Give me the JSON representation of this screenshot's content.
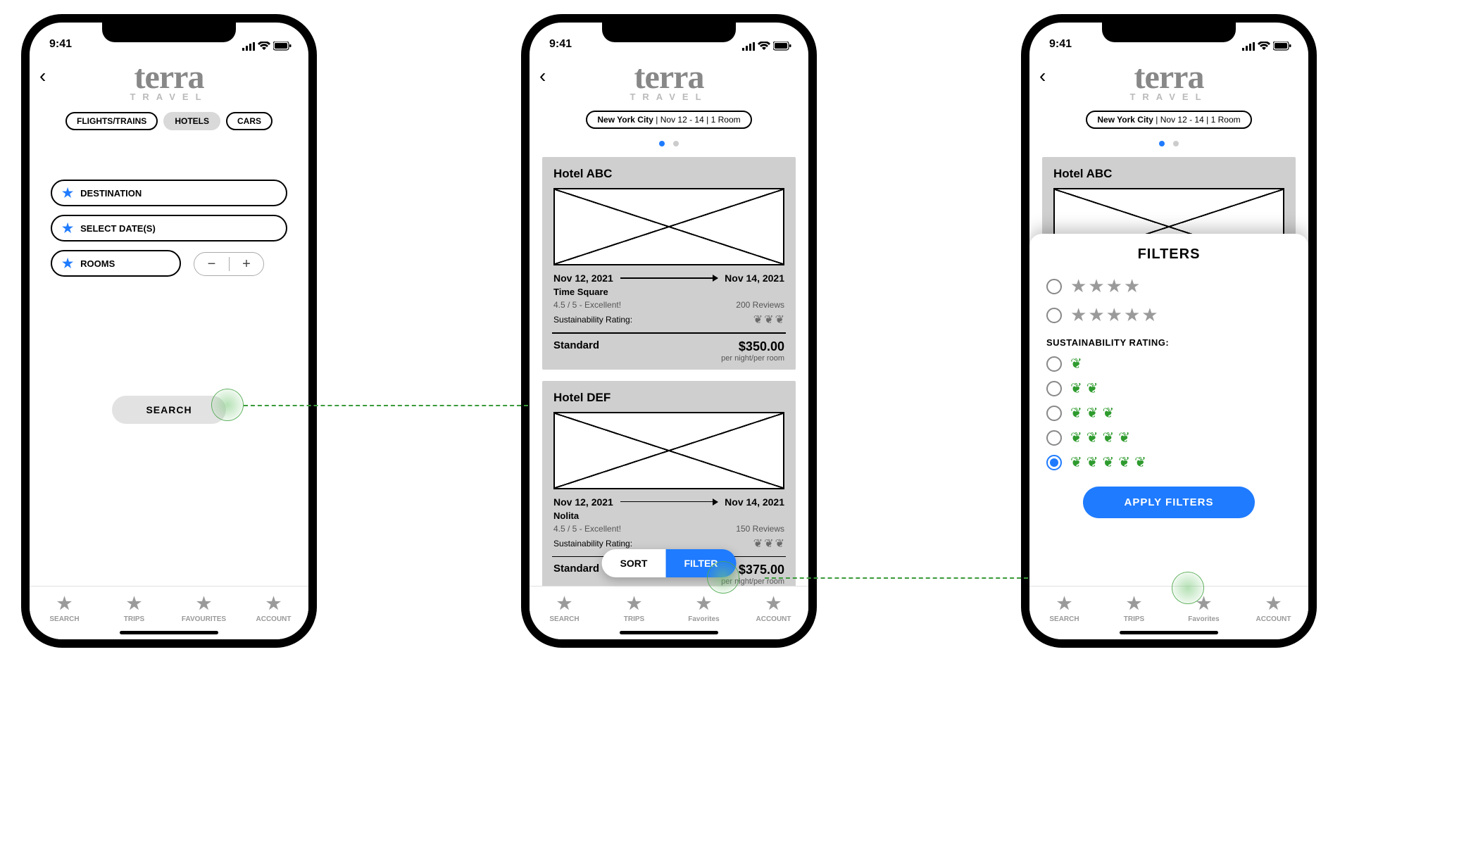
{
  "status": {
    "time": "9:41"
  },
  "brand": {
    "name": "terra",
    "tagline": "TRAVEL"
  },
  "screen1": {
    "tabs": {
      "flights": "FLIGHTS/TRAINS",
      "hotels": "HOTELS",
      "cars": "CARS",
      "selected": "hotels"
    },
    "inputs": {
      "destination": "DESTINATION",
      "dates": "SELECT DATE(S)",
      "rooms": "ROOMS"
    },
    "search_button": "SEARCH",
    "nav": {
      "search": "SEARCH",
      "trips": "TRIPS",
      "favourites": "FAVOURITES",
      "account": "ACCOUNT"
    }
  },
  "screen2": {
    "context": {
      "city": "New York City",
      "dates": "Nov 12 - 14",
      "rooms": "1 Room"
    },
    "results": [
      {
        "name": "Hotel ABC",
        "date_from": "Nov 12, 2021",
        "date_to": "Nov 14, 2021",
        "area": "Time Square",
        "rating_text": "4.5 / 5 - Excellent!",
        "reviews": "200 Reviews",
        "sust_label": "Sustainability Rating:",
        "sust_leaves": 3,
        "tier": "Standard",
        "price": "$350.00",
        "unit": "per night/per room"
      },
      {
        "name": "Hotel DEF",
        "date_from": "Nov 12, 2021",
        "date_to": "Nov 14, 2021",
        "area": "Nolita",
        "rating_text": "4.5 / 5 - Excellent!",
        "reviews": "150 Reviews",
        "sust_label": "Sustainability Rating:",
        "sust_leaves": 3,
        "tier": "Standard",
        "price": "$375.00",
        "unit": "per night/per room"
      }
    ],
    "sort_label": "SORT",
    "filter_label": "FILTER",
    "nav": {
      "search": "SEARCH",
      "trips": "TRIPS",
      "favourites": "Favorites",
      "account": "ACCOUNT"
    }
  },
  "screen3": {
    "context": {
      "city": "New York City",
      "dates": "Nov 12 - 14",
      "rooms": "1 Room"
    },
    "peek_result_name": "Hotel ABC",
    "filters": {
      "title": "FILTERS",
      "star_rows": [
        4,
        5
      ],
      "sust_label": "SUSTAINABILITY RATING:",
      "sust_rows": [
        1,
        2,
        3,
        4,
        5
      ],
      "sust_selected": 5,
      "apply": "APPLY FILTERS"
    },
    "nav": {
      "search": "SEARCH",
      "trips": "TRIPS",
      "favourites": "Favorites",
      "account": "ACCOUNT"
    }
  }
}
